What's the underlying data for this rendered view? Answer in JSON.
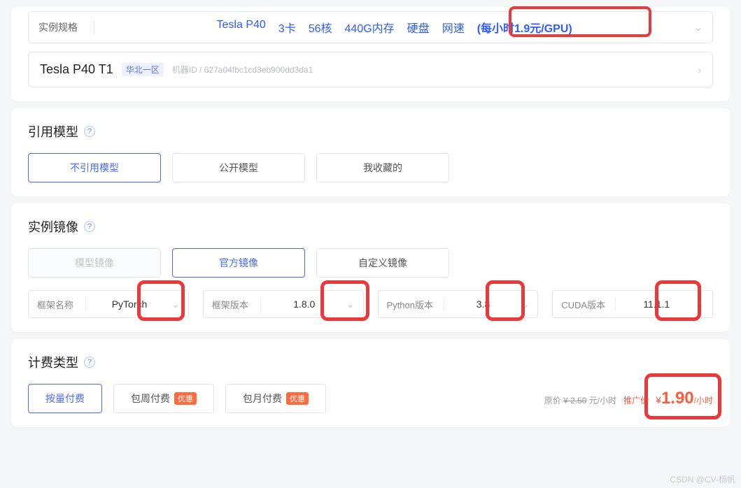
{
  "spec": {
    "label": "实例规格",
    "gpu": "Tesla P40",
    "cards": "3卡",
    "cores": "56核",
    "mem": "440G内存",
    "disk": "硬盘",
    "net": "网速",
    "price": "(每小时1.9元/GPU)"
  },
  "instance": {
    "title": "Tesla P40 T1",
    "region": "华北一区",
    "mid_label": "机器ID / 627a04fbc1cd3eb900dd3da1"
  },
  "model_ref": {
    "title": "引用模型",
    "tabs": [
      "不引用模型",
      "公开模型",
      "我收藏的"
    ]
  },
  "image": {
    "title": "实例镜像",
    "tabs": [
      "模型镜像",
      "官方镜像",
      "自定义镜像"
    ],
    "selects": {
      "framework": {
        "label": "框架名称",
        "value": "PyTorch"
      },
      "fw_ver": {
        "label": "框架版本",
        "value": "1.8.0"
      },
      "py_ver": {
        "label": "Python版本",
        "value": "3.8"
      },
      "cuda": {
        "label": "CUDA版本",
        "value": "11.1.1"
      }
    }
  },
  "billing": {
    "title": "计费类型",
    "options": [
      "按量付费",
      "包周付费",
      "包月付费"
    ],
    "discount": "优惠",
    "orig_label": "原价",
    "orig_price": "¥ 2.50",
    "orig_unit": " 元/小时",
    "promo_label": "推广价",
    "promo_cur": "¥",
    "promo_price": "1.90",
    "promo_unit": "/小时"
  },
  "watermark": "CSDN @CV-杨帆"
}
